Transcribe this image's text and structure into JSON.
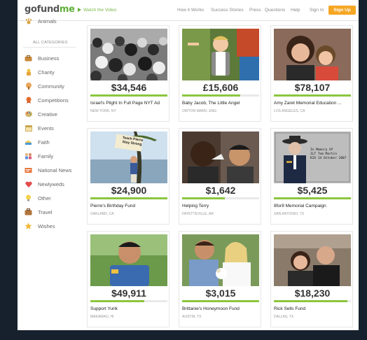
{
  "header": {
    "logo_part1": "gofund",
    "logo_part2": "me",
    "watch_video": "Watch the Video",
    "nav": [
      "How it Works",
      "Success Stories",
      "Press",
      "Questions",
      "Help",
      "Sign In"
    ],
    "signup": "Sign Up"
  },
  "sidebar": {
    "top_item": "Animals",
    "all_categories": "ALL CATEGORIES",
    "items": [
      {
        "label": "Business",
        "icon": "briefcase-icon"
      },
      {
        "label": "Charity",
        "icon": "charity-icon"
      },
      {
        "label": "Community",
        "icon": "community-icon"
      },
      {
        "label": "Competitions",
        "icon": "ribbon-icon"
      },
      {
        "label": "Creative",
        "icon": "palette-icon"
      },
      {
        "label": "Events",
        "icon": "calendar-icon"
      },
      {
        "label": "Faith",
        "icon": "faith-icon"
      },
      {
        "label": "Family",
        "icon": "family-icon"
      },
      {
        "label": "National News",
        "icon": "news-icon"
      },
      {
        "label": "Newlyweds",
        "icon": "heart-icon"
      },
      {
        "label": "Other",
        "icon": "lightbulb-icon"
      },
      {
        "label": "Travel",
        "icon": "suitcase-icon"
      },
      {
        "label": "Wishes",
        "icon": "star-icon"
      }
    ]
  },
  "campaigns": [
    {
      "amount": "$34,546",
      "title": "Israel's Plight In Full Page NYT Ad",
      "location": "NEW YORK, NY",
      "progress": 1.0
    },
    {
      "amount": "£15,606",
      "title": "Baby Jacob, The Little Angel",
      "location": "OWTON WARD, ENG",
      "progress": 0.75
    },
    {
      "amount": "$78,107",
      "title": "Amy Zaret Memorial Education ...",
      "location": "LOS ANGELES, CA",
      "progress": 1.0
    },
    {
      "amount": "$24,900",
      "title": "Pierre's Birthday Fund",
      "location": "OAKLAND, CA",
      "progress": 1.0
    },
    {
      "amount": "$1,642",
      "title": "Helping Terry",
      "location": "FAYETTEVILLE, AR",
      "progress": 0.55
    },
    {
      "amount": "$5,425",
      "title": "8for8 Memorial Campaign",
      "location": "SAN ANTONIO, TX",
      "progress": 1.0
    },
    {
      "amount": "$49,911",
      "title": "Support Yurik",
      "location": "MAKAWAO, HI",
      "progress": 0.7
    },
    {
      "amount": "$3,015",
      "title": "Brittanie's Honeymoon Fund",
      "location": "AUSTIN, TX",
      "progress": 1.0
    },
    {
      "amount": "$18,230",
      "title": "Rick Sells Fund",
      "location": "DALLAS, TX",
      "progress": 0.95
    }
  ],
  "photo_texts": {
    "sign_line1": "Teach Pierre",
    "sign_line2": "Stay Strong",
    "memorial_line1": "In Memory Of",
    "memorial_line2": "1LT Tom Martin",
    "memorial_line3": "KIA 14 October 2007"
  },
  "colors": {
    "brand_green": "#5fb038",
    "signup_orange": "#f5a623",
    "progress_green": "#8cc63e"
  }
}
